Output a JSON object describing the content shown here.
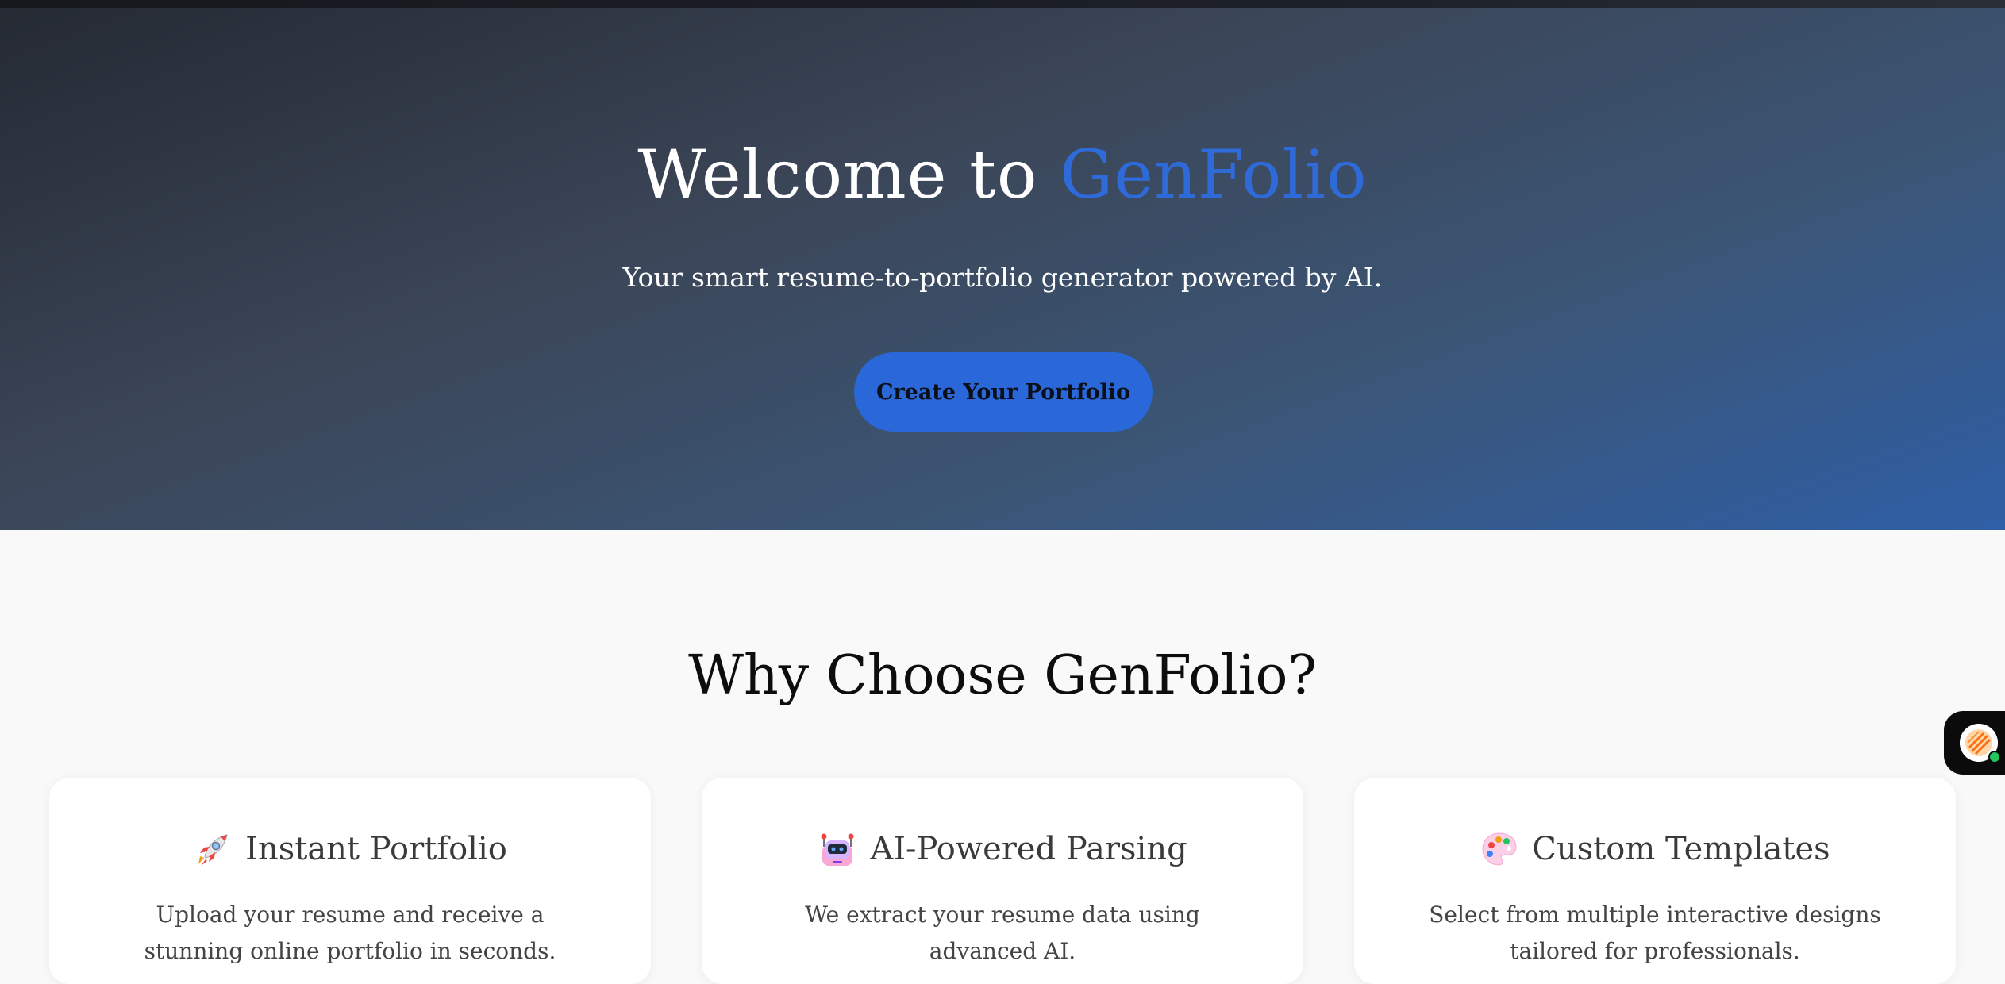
{
  "hero": {
    "title_prefix": "Welcome to ",
    "title_brand": "GenFolio",
    "subtitle": "Your smart resume-to-portfolio generator powered by AI.",
    "cta_label": "Create Your Portfolio"
  },
  "features": {
    "heading": "Why Choose GenFolio?",
    "cards": [
      {
        "icon": "rocket-icon",
        "title": "Instant Portfolio",
        "description": "Upload your resume and receive a stunning online portfolio in seconds."
      },
      {
        "icon": "robot-icon",
        "title": "AI-Powered Parsing",
        "description": "We extract your resume data using advanced AI."
      },
      {
        "icon": "palette-icon",
        "title": "Custom Templates",
        "description": "Select from multiple interactive designs tailored for professionals."
      }
    ]
  },
  "chat_widget": {
    "icon": "chat-avatar-icon",
    "status": "online"
  },
  "colors": {
    "brand_blue": "#2f6ad9",
    "button_blue": "#2a67d8",
    "hero_dark": "#252a33",
    "page_bg": "#f9f9f9"
  }
}
